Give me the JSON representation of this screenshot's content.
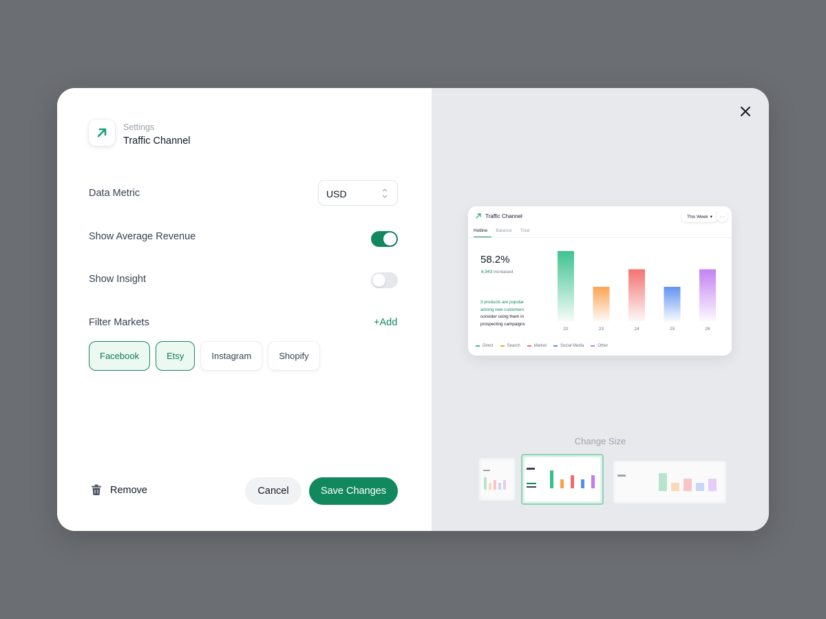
{
  "header": {
    "subtitle": "Settings",
    "title": "Traffic Channel"
  },
  "form": {
    "data_metric": {
      "label": "Data Metric",
      "value": "USD"
    },
    "show_average_revenue": {
      "label": "Show Average Revenue",
      "enabled": true
    },
    "show_insight": {
      "label": "Show Insight",
      "enabled": false
    },
    "filter_markets": {
      "label": "Filter Markets",
      "add_label": "+Add",
      "markets": [
        {
          "label": "Facebook",
          "active": true
        },
        {
          "label": "Etsy",
          "active": true
        },
        {
          "label": "Instagram",
          "active": false
        },
        {
          "label": "Shopify",
          "active": false
        }
      ]
    }
  },
  "footer": {
    "remove_label": "Remove",
    "cancel_label": "Cancel",
    "save_label": "Save Changes"
  },
  "preview": {
    "widget_title": "Traffic Channel",
    "period": "This Week",
    "more": "···",
    "tabs": [
      "Hotline",
      "Balance",
      "Total"
    ],
    "active_tab": "Hotline",
    "big_value": "58.2%",
    "increase_value": "6,943",
    "increase_text": "increased",
    "insight_highlight": "3 products are popular among new customers",
    "insight_rest": "consider using them in prospecting campaigns",
    "change_size_label": "Change Size",
    "selected_size": "medium"
  },
  "colors": {
    "accent": "#12885f",
    "accent_light": "#ecf8f2",
    "panel_bg": "#e8e9ec"
  },
  "chart_data": {
    "type": "bar",
    "categories": [
      "22",
      "23",
      "24",
      "25",
      "26"
    ],
    "values": [
      100,
      49,
      74,
      49,
      74
    ],
    "colors": [
      "#34c08a",
      "#fb9f4b",
      "#f26b6b",
      "#5b8def",
      "#c07cf2"
    ],
    "legend": [
      {
        "name": "Direct",
        "color": "#34c08a"
      },
      {
        "name": "Search",
        "color": "#fb9f4b"
      },
      {
        "name": "Market",
        "color": "#f26b6b"
      },
      {
        "name": "Social Media",
        "color": "#5b8def"
      },
      {
        "name": "Other",
        "color": "#c07cf2"
      }
    ],
    "ylim": [
      0,
      100
    ]
  }
}
